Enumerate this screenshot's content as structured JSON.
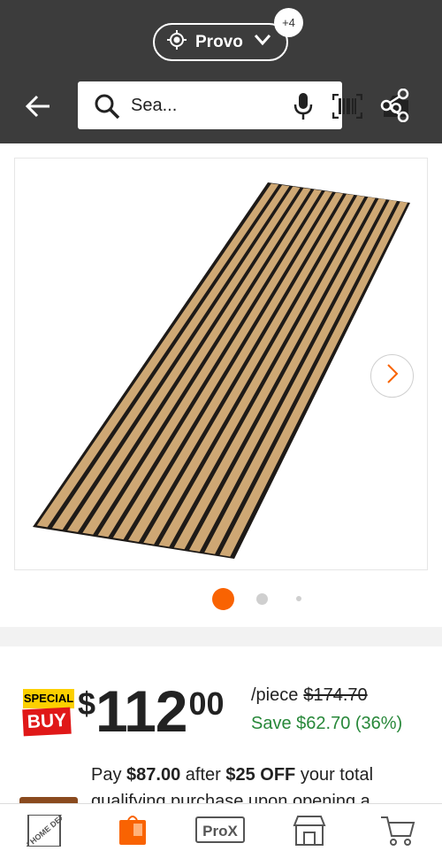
{
  "header": {
    "location": "Provo",
    "location_badge": "+4",
    "search_placeholder": "Sea..."
  },
  "product": {
    "image_alt": "Acoustic slat wood wall panel",
    "carousel": {
      "count": 3,
      "active_index": 0
    }
  },
  "pricing": {
    "special_top": "SPECIAL",
    "special_bottom": "BUY",
    "dollar_sign": "$",
    "price_whole": "112",
    "price_cents": "00",
    "unit": "/piece",
    "was_price": "$174.70",
    "save_text": "Save $62.70 (36%)"
  },
  "promo": {
    "pay_prefix": "Pay ",
    "pay_amount": "$87.00",
    "after": " after ",
    "off_amount": "$25 OFF",
    "rest": " your total qualifying purchase upon opening a"
  },
  "bottom_nav": {
    "items": [
      {
        "name": "home",
        "label": "THE HOME DEPOT"
      },
      {
        "name": "diy",
        "label": ""
      },
      {
        "name": "pro",
        "label": "ProX"
      },
      {
        "name": "store",
        "label": ""
      },
      {
        "name": "cart",
        "label": ""
      }
    ]
  },
  "colors": {
    "header_bg": "#3c3c3c",
    "accent": "#f96302",
    "save_green": "#28883a",
    "special_yellow": "#fcd000",
    "special_red": "#e01818"
  }
}
